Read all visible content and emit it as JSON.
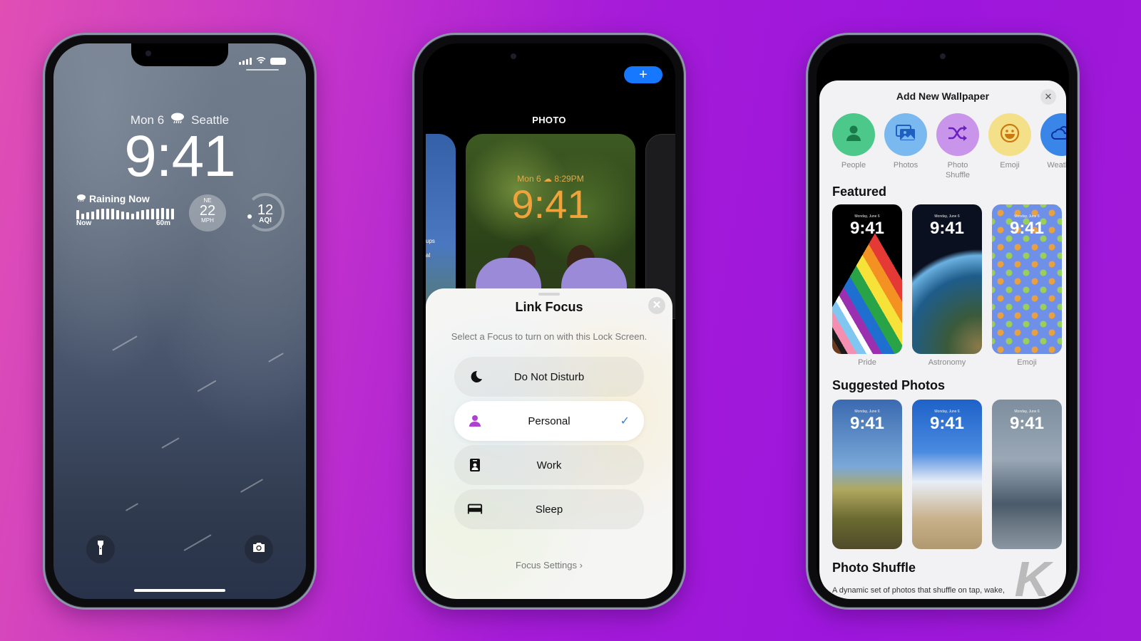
{
  "phone1": {
    "date": "Mon 6",
    "city": "Seattle",
    "time": "9:41",
    "rain_widget": {
      "title": "Raining Now",
      "start_label": "Now",
      "end_label": "60m",
      "intensity": [
        0.7,
        0.45,
        0.55,
        0.6,
        0.8,
        0.85,
        0.85,
        0.85,
        0.7,
        0.6,
        0.55,
        0.45,
        0.6,
        0.7,
        0.8,
        0.85,
        0.85,
        0.9,
        0.85,
        0.85
      ]
    },
    "wind_widget": {
      "direction": "NE",
      "value": "22",
      "unit": "MPH"
    },
    "aqi_widget": {
      "value": "12",
      "unit": "AQI",
      "level": 0.12
    },
    "quick_actions": {
      "left": "flashlight-icon",
      "right": "camera-icon"
    }
  },
  "phone2": {
    "add_button_label": "+",
    "category_label": "PHOTO",
    "preview": {
      "date": "Mon 6",
      "sunset_time": "8:29PM",
      "time": "9:41"
    },
    "left_card_text": [
      "ups",
      "al"
    ],
    "sheet": {
      "title": "Link Focus",
      "close_label": "✕",
      "subtitle": "Select a Focus to turn on with this Lock Screen.",
      "options": [
        {
          "label": "Do Not Disturb",
          "icon": "moon-icon",
          "selected": false
        },
        {
          "label": "Personal",
          "icon": "person-icon",
          "selected": true
        },
        {
          "label": "Work",
          "icon": "badge-icon",
          "selected": false
        },
        {
          "label": "Sleep",
          "icon": "bed-icon",
          "selected": false
        }
      ],
      "check_mark": "✓",
      "settings_link": "Focus Settings ›"
    },
    "colors": {
      "accent": "#1677ff",
      "personal": "#b040d0",
      "preview_text": "#f0a33a"
    }
  },
  "phone3": {
    "title": "Add New Wallpaper",
    "close_label": "✕",
    "categories": [
      {
        "label": "People",
        "icon": "person-icon",
        "color": "#4cc98a"
      },
      {
        "label": "Photos",
        "icon": "photos-icon",
        "color": "#7ab9ef"
      },
      {
        "label": "Photo Shuffle",
        "icon": "shuffle-icon",
        "color": "#c995ea"
      },
      {
        "label": "Emoji",
        "icon": "smiley-icon",
        "color": "#f5e08a"
      },
      {
        "label": "Weather",
        "icon": "weather-icon",
        "color": "#3a86e8"
      }
    ],
    "featured": {
      "title": "Featured",
      "items": [
        {
          "label": "Pride",
          "date": "Monday, June 6",
          "time": "9:41"
        },
        {
          "label": "Astronomy",
          "date": "Monday, June 6",
          "time": "9:41"
        },
        {
          "label": "Emoji",
          "date": "Monday, June 6",
          "time": "9:41"
        }
      ]
    },
    "suggested": {
      "title": "Suggested Photos",
      "items": [
        {
          "date": "Monday, June 6",
          "time": "9:41"
        },
        {
          "date": "Monday, June 6",
          "time": "9:41"
        },
        {
          "date": "Monday, June 6",
          "time": "9:41"
        }
      ]
    },
    "photo_shuffle": {
      "title": "Photo Shuffle",
      "description": "A dynamic set of photos that shuffle on tap, wake,"
    }
  },
  "watermark": "K"
}
